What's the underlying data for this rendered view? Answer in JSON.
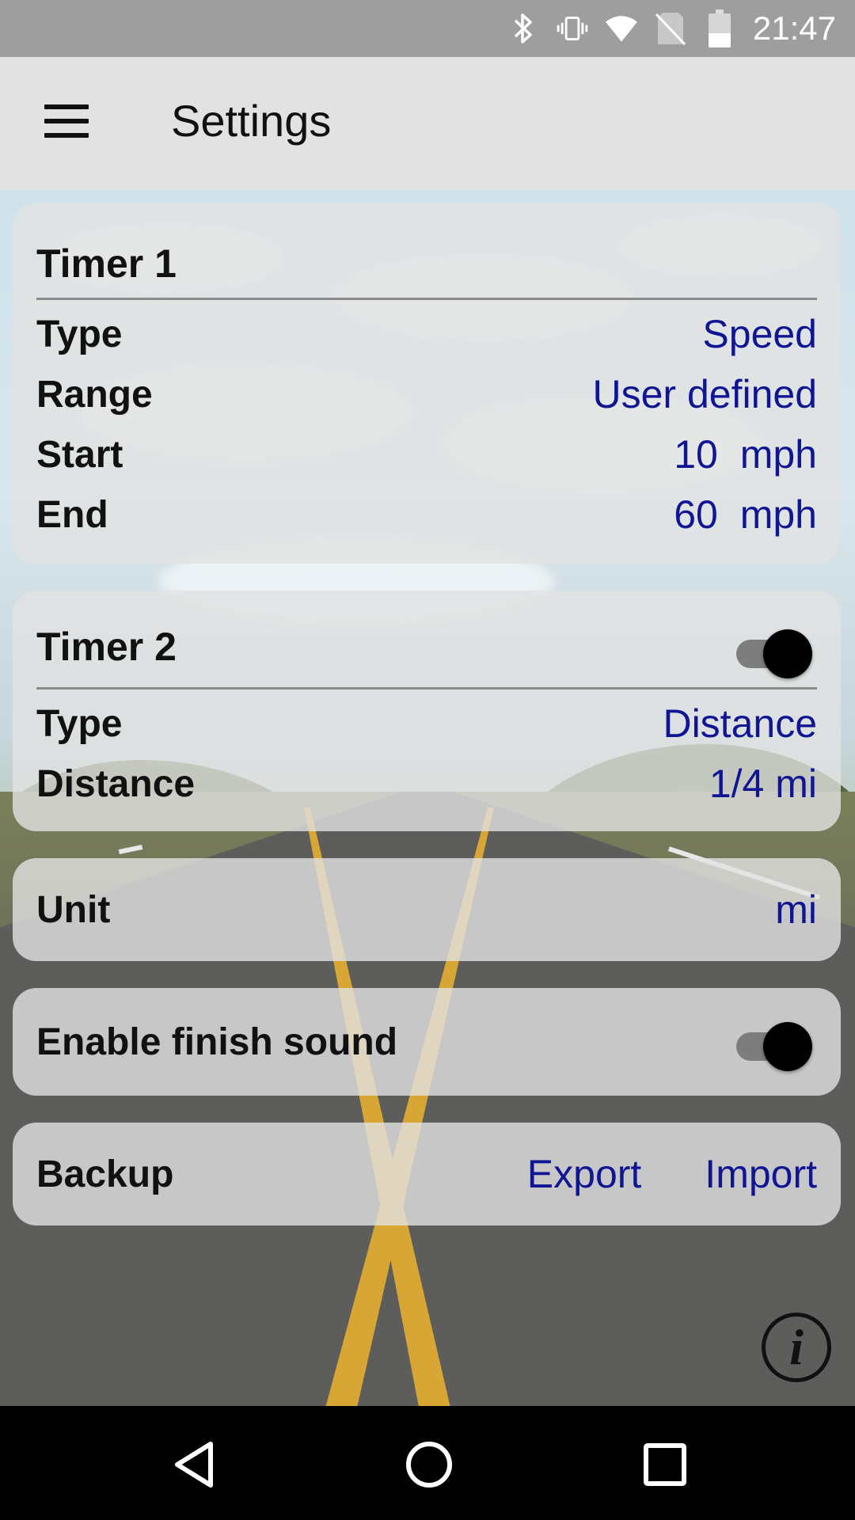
{
  "status_bar": {
    "time": "21:47",
    "icons": [
      "bluetooth-icon",
      "vibrate-icon",
      "wifi-icon",
      "no-sim-icon",
      "battery-icon"
    ]
  },
  "app_bar": {
    "title": "Settings",
    "menu_icon": "hamburger-menu-icon"
  },
  "timer1": {
    "title": "Timer 1",
    "rows": [
      {
        "label": "Type",
        "value": "Speed"
      },
      {
        "label": "Range",
        "value": "User defined"
      },
      {
        "label": "Start",
        "value": "10 mph"
      },
      {
        "label": "End",
        "value": "60 mph"
      }
    ]
  },
  "timer2": {
    "title": "Timer 2",
    "enabled": true,
    "rows": [
      {
        "label": "Type",
        "value": "Distance"
      },
      {
        "label": "Distance",
        "value": "1/4 mi"
      }
    ]
  },
  "unit": {
    "label": "Unit",
    "value": "mi"
  },
  "finish_sound": {
    "label": "Enable finish sound",
    "enabled": true
  },
  "backup": {
    "label": "Backup",
    "export_label": "Export",
    "import_label": "Import"
  },
  "info_icon": "info-icon",
  "nav_bar": {
    "icons": [
      "back-icon",
      "home-icon",
      "recents-icon"
    ]
  },
  "colors": {
    "value_text": "#101593",
    "status_bar": "#9e9e9e",
    "app_bar": "#e2e2e2",
    "nav_bar": "#000000"
  }
}
